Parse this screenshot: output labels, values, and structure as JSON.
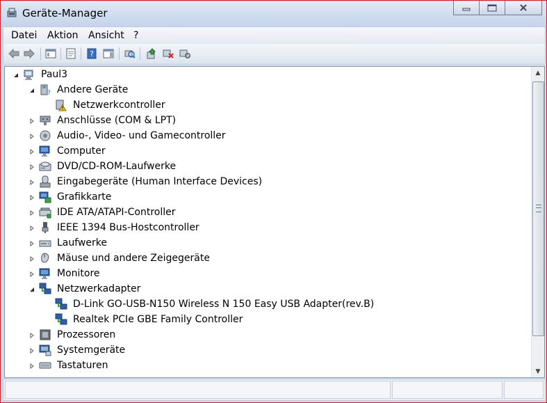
{
  "window": {
    "title": "Geräte-Manager",
    "icon": "device-manager-icon",
    "caption_buttons": {
      "minimize": "minimize-icon",
      "maximize": "maximize-icon",
      "close": "close-icon"
    }
  },
  "menu": [
    "Datei",
    "Aktion",
    "Ansicht",
    "?"
  ],
  "toolbar": [
    {
      "name": "back",
      "icon": "arrow-left-icon"
    },
    {
      "name": "forward",
      "icon": "arrow-right-icon"
    },
    {
      "name": "show-hide-console-tree",
      "icon": "console-tree-icon"
    },
    {
      "name": "properties",
      "icon": "properties-icon"
    },
    {
      "name": "help",
      "icon": "help-icon"
    },
    {
      "name": "show-action-pane",
      "icon": "action-pane-icon"
    },
    {
      "name": "scan-hardware",
      "icon": "scan-hardware-icon"
    },
    {
      "name": "update-driver",
      "icon": "update-driver-icon"
    },
    {
      "name": "uninstall",
      "icon": "uninstall-icon"
    },
    {
      "name": "disable",
      "icon": "disable-icon"
    }
  ],
  "tree": {
    "root": {
      "label": "Paul3",
      "expanded": true,
      "icon": "computer-icon"
    },
    "nodes": [
      {
        "label": "Andere Geräte",
        "level": 1,
        "expanded": true,
        "icon": "other-devices-icon"
      },
      {
        "label": "Netzwerkcontroller",
        "level": 2,
        "icon": "warning-device-icon"
      },
      {
        "label": "Anschlüsse (COM & LPT)",
        "level": 1,
        "expanded": false,
        "icon": "ports-icon"
      },
      {
        "label": "Audio-, Video- und Gamecontroller",
        "level": 1,
        "expanded": false,
        "icon": "audio-icon"
      },
      {
        "label": "Computer",
        "level": 1,
        "expanded": false,
        "icon": "monitor-icon"
      },
      {
        "label": "DVD/CD-ROM-Laufwerke",
        "level": 1,
        "expanded": false,
        "icon": "dvd-drive-icon"
      },
      {
        "label": "Eingabegeräte (Human Interface Devices)",
        "level": 1,
        "expanded": false,
        "icon": "hid-icon"
      },
      {
        "label": "Grafikkarte",
        "level": 1,
        "expanded": false,
        "icon": "display-adapter-icon"
      },
      {
        "label": "IDE ATA/ATAPI-Controller",
        "level": 1,
        "expanded": false,
        "icon": "ide-controller-icon"
      },
      {
        "label": "IEEE 1394 Bus-Hostcontroller",
        "level": 1,
        "expanded": false,
        "icon": "firewire-icon"
      },
      {
        "label": "Laufwerke",
        "level": 1,
        "expanded": false,
        "icon": "disk-drive-icon"
      },
      {
        "label": "Mäuse und andere Zeigegeräte",
        "level": 1,
        "expanded": false,
        "icon": "mouse-icon"
      },
      {
        "label": "Monitore",
        "level": 1,
        "expanded": false,
        "icon": "monitor-icon"
      },
      {
        "label": "Netzwerkadapter",
        "level": 1,
        "expanded": true,
        "icon": "network-adapter-icon"
      },
      {
        "label": "D-Link GO-USB-N150 Wireless N 150 Easy USB Adapter(rev.B)",
        "level": 2,
        "icon": "network-adapter-icon"
      },
      {
        "label": "Realtek PCIe GBE Family Controller",
        "level": 2,
        "icon": "network-adapter-icon"
      },
      {
        "label": "Prozessoren",
        "level": 1,
        "expanded": false,
        "icon": "processor-icon"
      },
      {
        "label": "Systemgeräte",
        "level": 1,
        "expanded": false,
        "icon": "system-devices-icon"
      },
      {
        "label": "Tastaturen",
        "level": 1,
        "expanded": false,
        "icon": "keyboard-icon"
      }
    ]
  },
  "colors": {
    "title_bar": "#c4d5ea",
    "window_border": "#c8202a",
    "tree_background": "#ffffff"
  }
}
